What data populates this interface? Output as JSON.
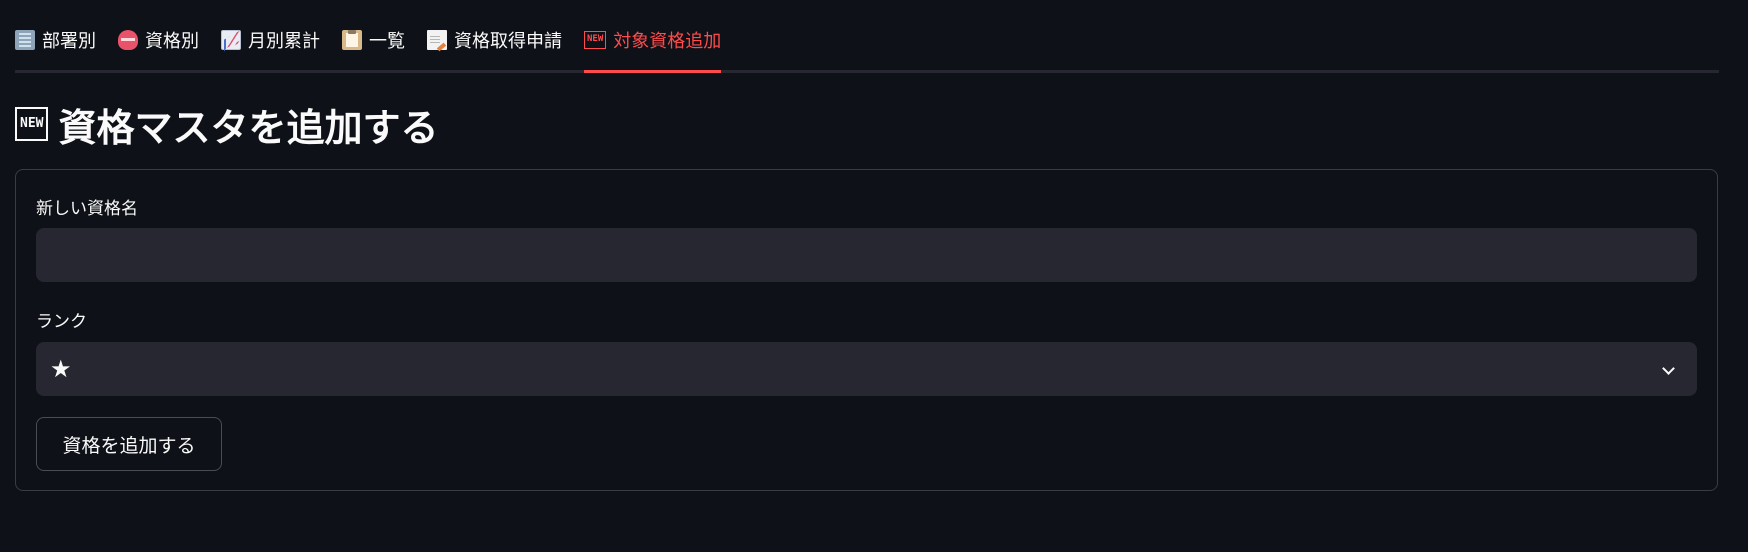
{
  "tabs": [
    {
      "label": "部署別",
      "icon": "building-icon"
    },
    {
      "label": "資格別",
      "icon": "badge-icon"
    },
    {
      "label": "月別累計",
      "icon": "chart-increasing-icon"
    },
    {
      "label": "一覧",
      "icon": "clipboard-icon"
    },
    {
      "label": "資格取得申請",
      "icon": "memo-icon"
    },
    {
      "label": "対象資格追加",
      "icon": "new-icon",
      "icon_text": "NEW",
      "active": true
    }
  ],
  "page": {
    "title_icon_text": "NEW",
    "title": "資格マスタを追加する"
  },
  "form": {
    "name_label": "新しい資格名",
    "name_value": "",
    "rank_label": "ランク",
    "rank_value": "★",
    "submit_label": "資格を追加する"
  },
  "colors": {
    "background": "#0e1117",
    "accent": "#ff4b4b",
    "input_bg": "#262730",
    "text": "#fafafa"
  }
}
